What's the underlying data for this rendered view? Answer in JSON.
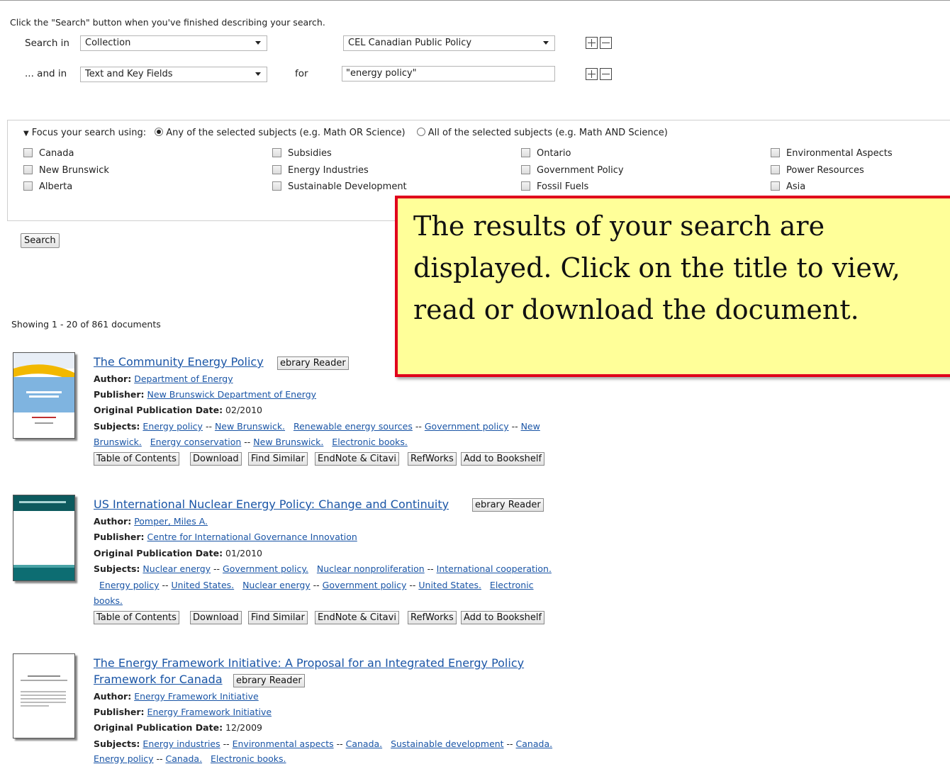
{
  "instruction": "Click the \"Search\" button when you've finished describing your search.",
  "row1": {
    "label": "Search in",
    "field": "Collection",
    "value": "CEL Canadian Public Policy"
  },
  "row2": {
    "label": "... and in",
    "field": "Text and Key Fields",
    "for_label": "for",
    "query": "\"energy policy\""
  },
  "focus": {
    "label": "Focus your search using:",
    "any_label": "Any of the selected subjects (e.g. Math OR Science)",
    "all_label": "All of the selected subjects (e.g. Math AND Science)",
    "selected": "any",
    "subjects": [
      "Canada",
      "Subsidies",
      "Ontario",
      "Environmental Aspects",
      "New Brunswick",
      "Energy Industries",
      "Government Policy",
      "Power Resources",
      "Alberta",
      "Sustainable Development",
      "Fossil Fuels",
      "Asia"
    ]
  },
  "search_button": "Search",
  "showing": "Showing 1 - 20 of 861 documents",
  "labels": {
    "author": "Author:",
    "publisher": "Publisher:",
    "date": "Original Publication Date:",
    "subjects": "Subjects:",
    "sep": " -- "
  },
  "reader_button": "ebrary Reader",
  "actions": [
    "Table of Contents",
    "Download",
    "Find Similar",
    "EndNote & Citavi",
    "RefWorks",
    "Add to Bookshelf"
  ],
  "results": [
    {
      "title": "The Community Energy Policy",
      "author": "Department of Energy",
      "publisher": "New Brunswick Department of Energy",
      "date": "02/2010",
      "subjects_line1": [
        "Energy policy",
        "New Brunswick.",
        "Renewable energy sources",
        "Government policy",
        "New"
      ],
      "subjects_line2": [
        "Brunswick.",
        "Energy conservation",
        "New Brunswick.",
        "Electronic books."
      ]
    },
    {
      "title": "US International Nuclear Energy Policy: Change and Continuity",
      "author": "Pomper, Miles A.",
      "publisher": "Centre for International Governance Innovation",
      "date": "01/2010",
      "subjects_line1": [
        "Nuclear energy",
        "Government policy.",
        "Nuclear nonproliferation",
        "International cooperation."
      ],
      "subjects_line2": [
        "Energy policy",
        "United States.",
        "Nuclear energy",
        "Government policy",
        "United States.",
        "Electronic"
      ],
      "subjects_line3": [
        "books."
      ]
    },
    {
      "title_line1": "The Energy Framework Initiative: A Proposal for an Integrated Energy Policy",
      "title_line2": "Framework for Canada",
      "author": "Energy Framework Initiative",
      "publisher": "Energy Framework Initiative",
      "date": "12/2009",
      "subjects_line1": [
        "Energy industries",
        "Environmental aspects",
        "Canada.",
        "Sustainable development",
        "Canada."
      ],
      "subjects_line2": [
        "Energy policy",
        "Canada.",
        "Electronic books."
      ]
    }
  ],
  "callout": "The results of your search are displayed. Click on the title to view, read or download the document."
}
